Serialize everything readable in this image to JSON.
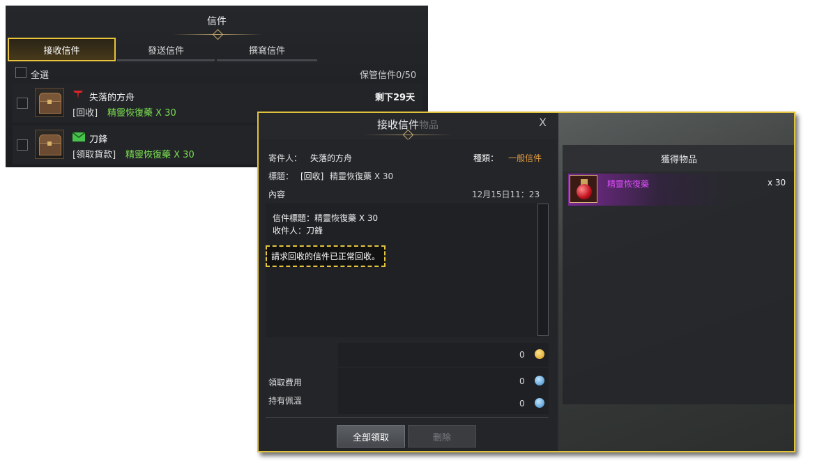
{
  "mail_window": {
    "title": "信件",
    "tabs": [
      {
        "label": "接收信件",
        "active": true
      },
      {
        "label": "發送信件",
        "active": false
      },
      {
        "label": "撰寫信件",
        "active": false
      }
    ],
    "select_all": "全選",
    "storage_count": "保管信件0/50",
    "mails": [
      {
        "sender": "失落的方舟",
        "subject_prefix": "[回收]",
        "subject_item": "精靈恢復藥 X 30",
        "remaining": "剩下29天",
        "icon": "red-t-icon"
      },
      {
        "sender": "刀鋒",
        "subject_prefix": "[領取貨款]",
        "subject_item": "精靈恢復藥 X 30",
        "remaining": "",
        "icon": "green-envelope-icon"
      }
    ]
  },
  "dialog": {
    "title": "接收信件",
    "title_ghost": "物品",
    "close": "X",
    "sender_label": "寄件人：",
    "sender": "失落的方舟",
    "type_label": "種類：",
    "type_value": "一般信件",
    "subject_label": "標題：",
    "subject_prefix": "[回收]",
    "subject_item": "精靈恢復藥 X 30",
    "content_label": "內容",
    "datetime": "12月15日11：23",
    "body_line1": "信件標題：精靈恢復藥 X 30",
    "body_line2": "收件人：刀鋒",
    "notice": "請求回收的信件已正常回收。",
    "gold_amount": "0",
    "fee_label": "領取費用",
    "fee_amount": "0",
    "owned_label": "持有佩溫",
    "owned_amount": "0",
    "btn_take_all": "全部領取",
    "btn_delete": "刪除",
    "obtain_title": "獲得物品",
    "obtained_item": "精靈恢復藥",
    "obtained_qty": "x 30"
  },
  "colors": {
    "accent_border": "#e1c23c",
    "green_text": "#7be050",
    "orange_text": "#e8a040",
    "purple_text": "#e04cff"
  }
}
